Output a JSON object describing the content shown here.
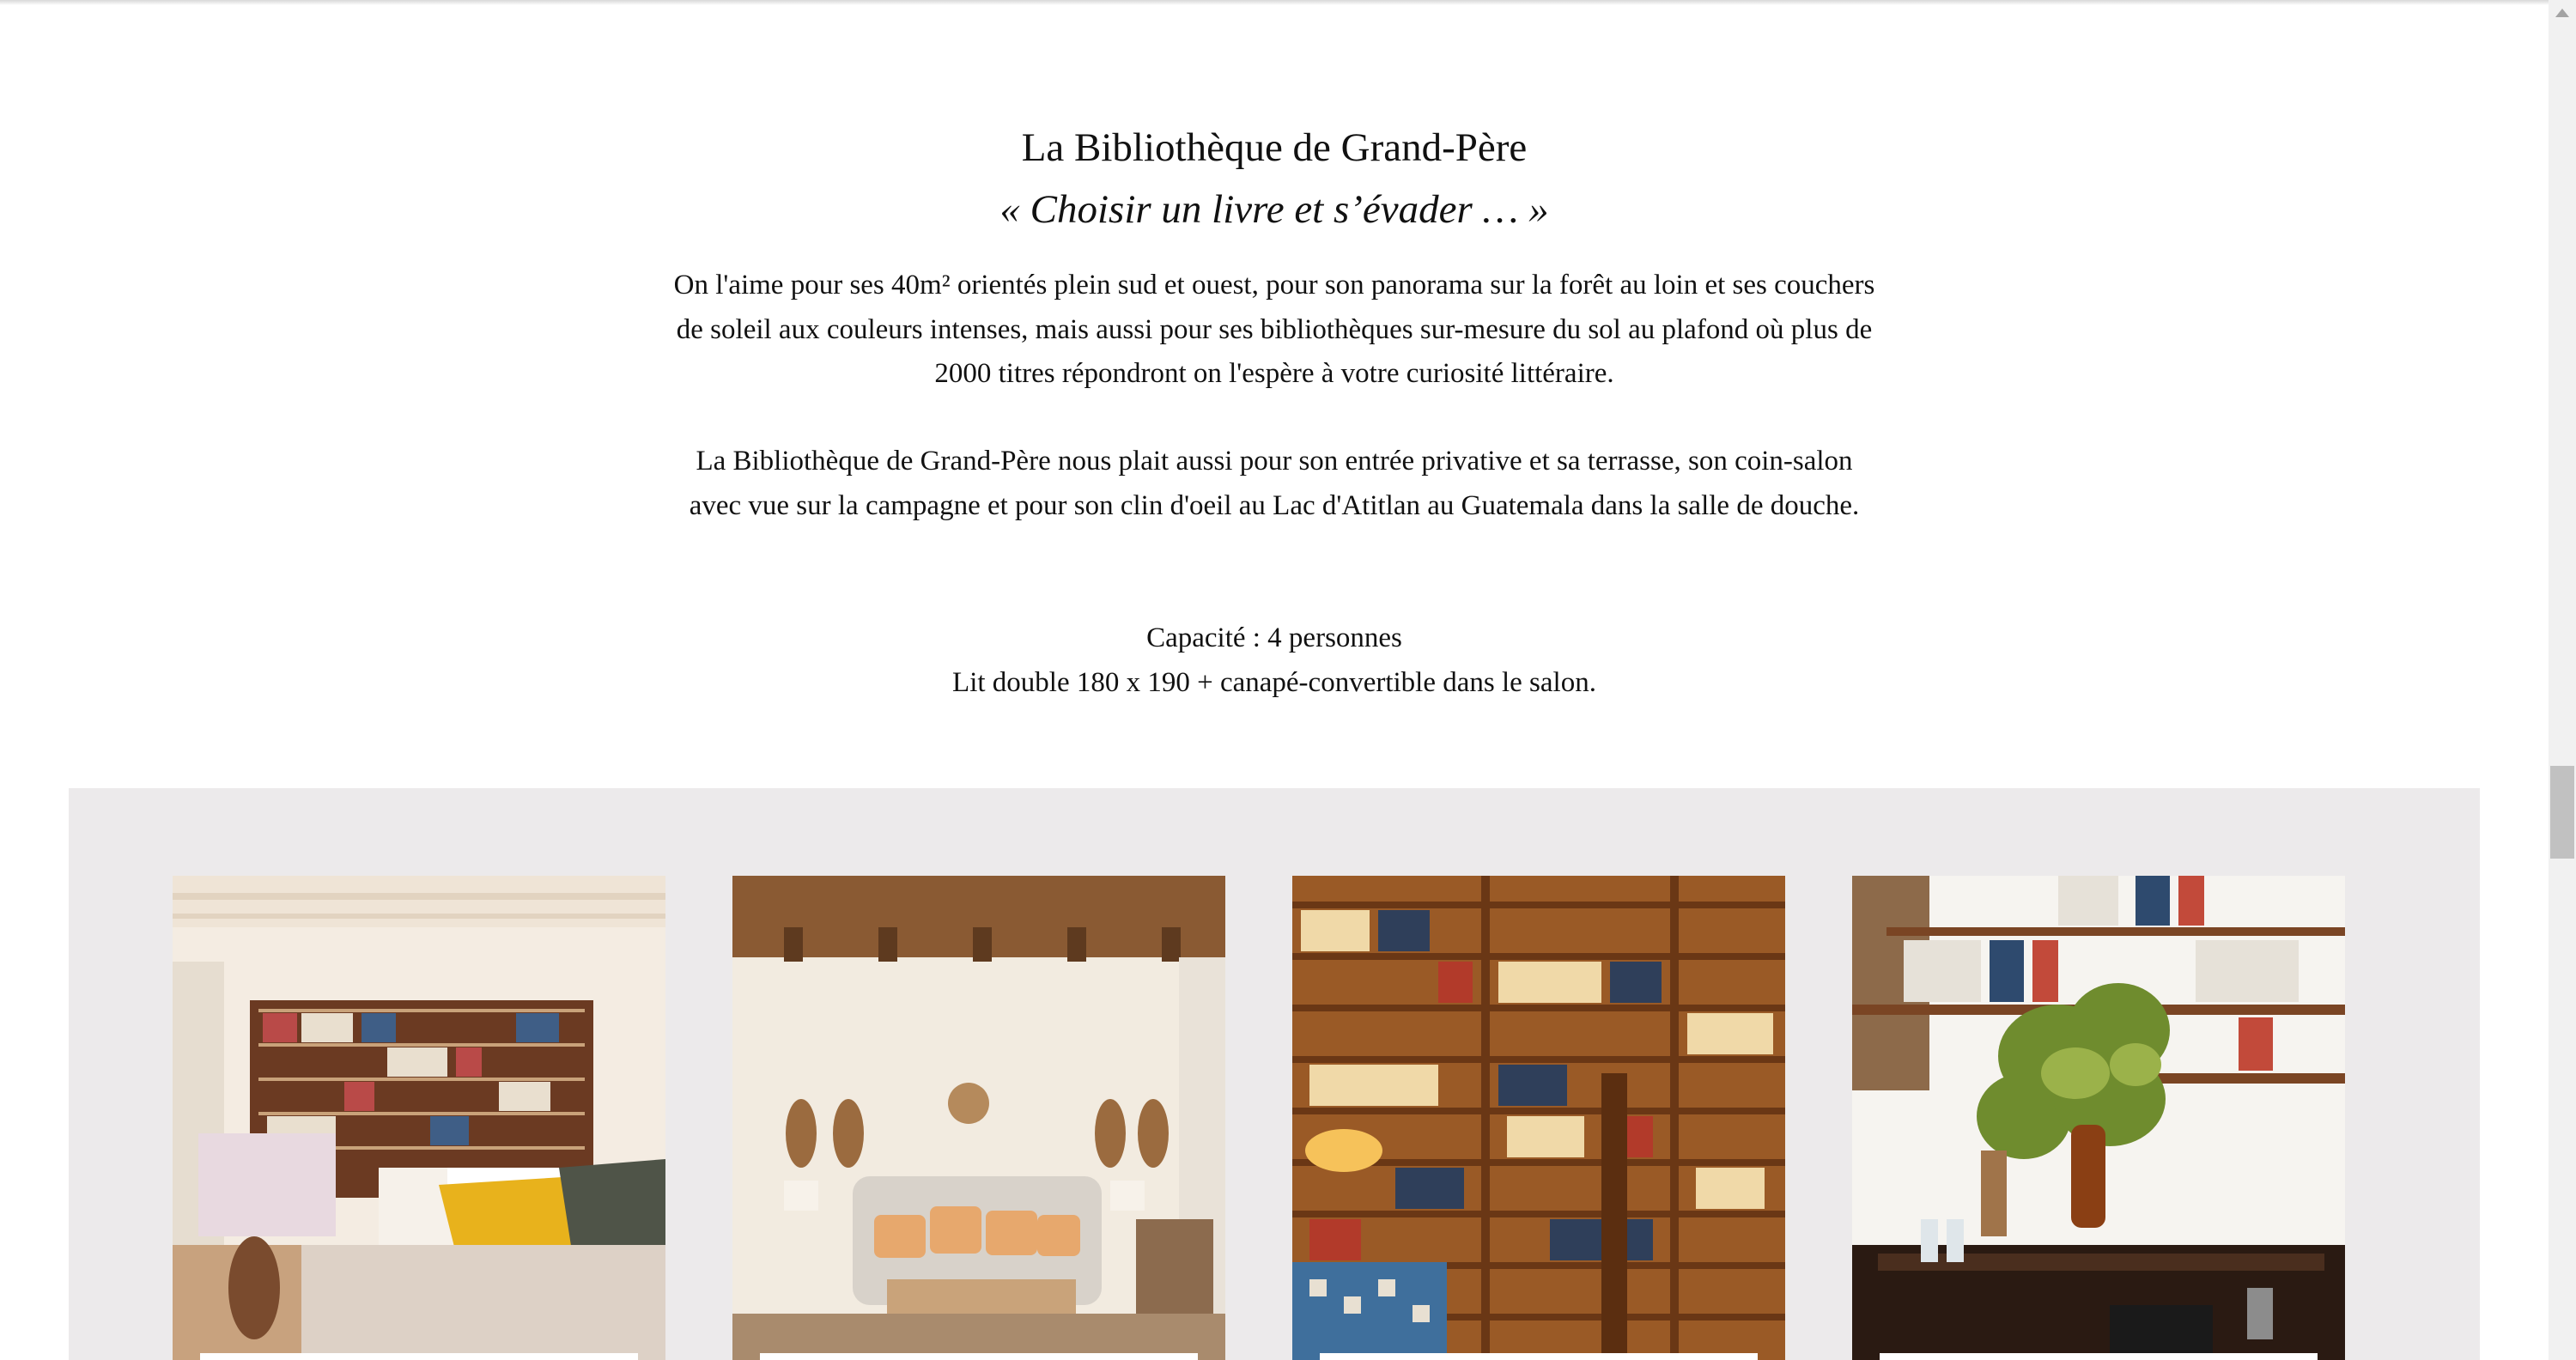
{
  "section": {
    "title": "La Bibliothèque de Grand-Père",
    "subtitle": "«  Choisir un livre et s’évader … »",
    "paragraph1": "On l'aime pour ses 40m² orientés plein sud et ouest, pour son panorama sur la forêt au loin et ses couchers de soleil aux couleurs intenses, mais aussi pour ses bibliothèques sur-mesure du sol au plafond où plus de 2000 titres répondront on l'espère à votre curiosité littéraire.",
    "paragraph2": "La Bibliothèque de Grand-Père nous plait aussi pour son entrée privative et sa terrasse, son coin-salon avec vue sur la campagne et pour son clin d'oeil au Lac d'Atitlan au Guatemala dans la salle de douche.",
    "capacity": "Capacité : 4 personnes",
    "beds": "Lit double 180 x 190 + canapé-convertible dans le salon."
  },
  "gallery": {
    "background": "#eceaeb",
    "photos": [
      "bedroom-bookshelves-photo",
      "living-corner-sofa-photo",
      "library-wall-photo",
      "entry-shelves-plant-photo"
    ]
  }
}
